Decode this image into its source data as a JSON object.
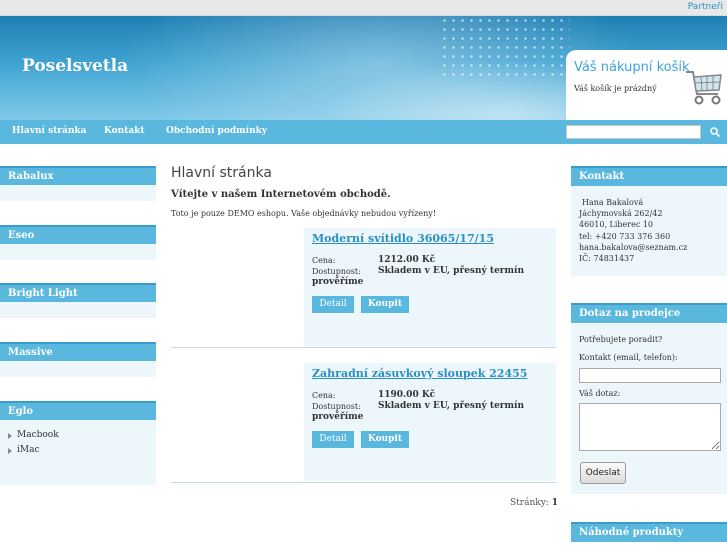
{
  "topbar": {
    "partners_link": "Partneři"
  },
  "header": {
    "logo": "Poselsvetla"
  },
  "cart": {
    "title": "Váš nákupní košík",
    "status": "Váš košík je prázdný"
  },
  "nav": {
    "items": [
      "Hlavní stránka",
      "Kontakt",
      "Obchodní podmínky"
    ]
  },
  "search": {
    "placeholder": ""
  },
  "left_boxes": [
    {
      "title": "Rabalux"
    },
    {
      "title": "Eseo"
    },
    {
      "title": "Bright Light"
    },
    {
      "title": "Massive"
    },
    {
      "title": "Eglo",
      "items": [
        "Macbook",
        "iMac"
      ]
    }
  ],
  "main": {
    "title": "Hlavní stránka",
    "welcome": "Vítejte v našem Internetovém obchodě.",
    "demo_note": "Toto je pouze DEMO eshopu. Vaše objednávky nebudou vyřízeny!",
    "price_label": "Cena:",
    "availability_label": "Dostupnost:",
    "detail_button": "Detail",
    "buy_button": "Koupit",
    "products": [
      {
        "name": "Moderní svítidlo 36065/17/15",
        "price": "1212.00 Kč",
        "availability_a": "Skladem v EU, přesný termín",
        "availability_b": "prověříme"
      },
      {
        "name": "Zahradní zásuvkový sloupek 22455",
        "price": "1190.00 Kč",
        "availability_a": "Skladem v EU, přesný termín",
        "availability_b": "prověříme"
      }
    ],
    "pager_label": "Stránky:",
    "pager_page": "1"
  },
  "right": {
    "contact_title": "Kontakt",
    "contact_lines": [
      "Hana Bakalová",
      "Jáchymovská 262/42",
      "46010, Liberec 10",
      "tel: +420 733 376 360",
      "hana.bakalova@seznam.cz",
      "IČ: 74831437"
    ],
    "ask_title": "Dotaz na prodejce",
    "ask_intro": "Potřebujete poradit?",
    "ask_contact_label": "Kontakt (email, telefon):",
    "ask_question_label": "Váš dotaz:",
    "send_button": "Odeslat",
    "random_title": "Náhodné produkty"
  },
  "colors": {
    "accent": "#5ab8de",
    "link": "#2a8fc4",
    "panel": "#edf7fb"
  }
}
